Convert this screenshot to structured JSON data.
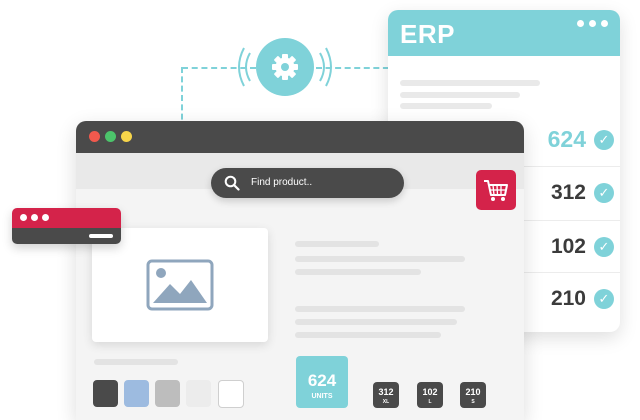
{
  "erp": {
    "title": "ERP",
    "rows": [
      {
        "value": "624",
        "accent": true
      },
      {
        "value": "312",
        "accent": false
      },
      {
        "value": "102",
        "accent": false
      },
      {
        "value": "210",
        "accent": false
      }
    ]
  },
  "connector": {
    "icon": "gear-icon"
  },
  "search": {
    "placeholder": "Find product..",
    "icon": "search-icon"
  },
  "cart": {
    "icon": "shopping-cart-icon"
  },
  "product": {
    "image_icon": "image-placeholder-icon",
    "swatches": [
      "#4a4a4a",
      "#9dbbe0",
      "#bdbdbd",
      "#ececec",
      "#ffffff"
    ],
    "units": {
      "value": "624",
      "label": "UNITS"
    },
    "sizes": [
      {
        "value": "312",
        "label": "XL"
      },
      {
        "value": "102",
        "label": "L"
      },
      {
        "value": "210",
        "label": "S"
      }
    ]
  },
  "colors": {
    "accent": "#7fd2d9",
    "brand_red": "#d4234a",
    "dark": "#4a4a4a",
    "traffic_lights": [
      "#f0594d",
      "#4cc46b",
      "#f7d54a"
    ]
  }
}
